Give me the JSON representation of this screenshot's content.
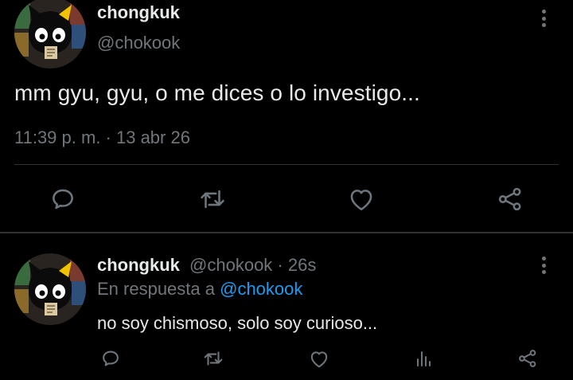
{
  "main_tweet": {
    "display_name": "chongkuk",
    "handle": "@chokook",
    "text": "mm gyu, gyu, o me dices o lo investigo...",
    "timestamp": "11:39 p. m. · 13 abr 26",
    "actions": [
      "reply-icon",
      "retweet-icon",
      "like-icon",
      "share-icon"
    ]
  },
  "reply": {
    "display_name": "chongkuk",
    "handle": "@chokook",
    "separator": " · ",
    "time_ago": "26s",
    "replying_prefix": "En respuesta a ",
    "replying_mention": "@chokook",
    "text": "no soy chismoso, solo soy curioso...",
    "actions": [
      "reply-icon",
      "retweet-icon",
      "like-icon",
      "views-icon",
      "share-icon"
    ]
  },
  "colors": {
    "background": "#000000",
    "text_primary": "#e7e9ea",
    "text_secondary": "#71767b",
    "mention": "#1d9bf0",
    "divider": "#2f3336",
    "icon": "#6e767d"
  }
}
